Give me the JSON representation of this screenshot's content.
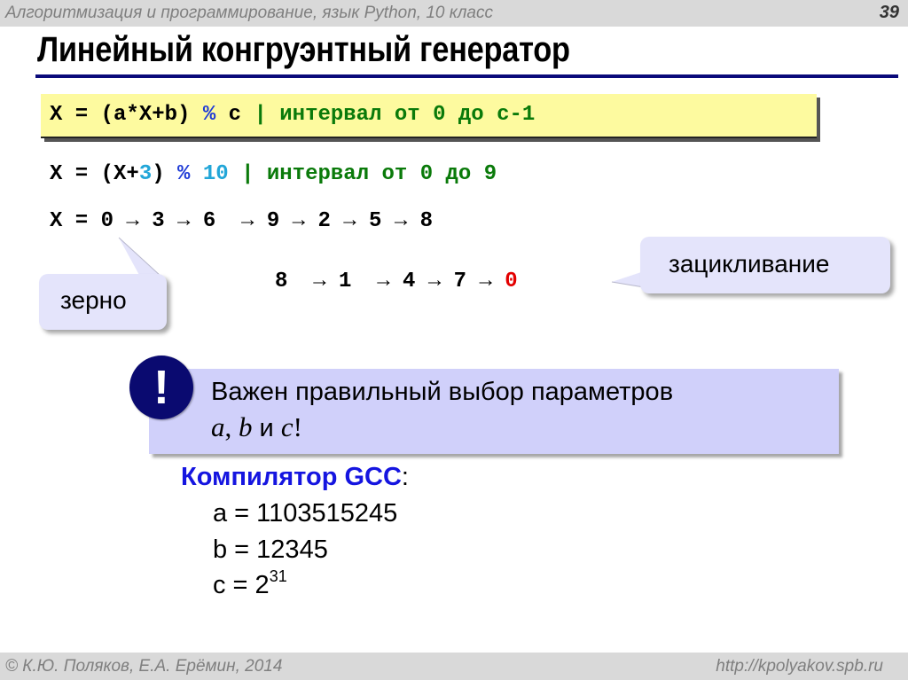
{
  "header": {
    "course": "Алгоритмизация и программирование, язык Python, 10 класс",
    "slide_number": "39"
  },
  "title": "Линейный конгруэнтный генератор",
  "formula": {
    "lhs": "X = (a*X+b) ",
    "op": "%",
    "rhs": " c ",
    "comment": "| интервал от 0 до c-1"
  },
  "example": {
    "prefix": "X = (X+",
    "inc": "3",
    "mid": ") ",
    "op": "%",
    "sp": " ",
    "mod": "10",
    "comment": " | интервал от 0 до 9"
  },
  "sequence": {
    "row1": "X = 0 → 3 → 6  → 9 → 2 → 5 → 8",
    "row2_prefix": "8  → 1  → 4 → 7 → ",
    "row2_last": "0"
  },
  "callouts": {
    "seed": "зерно",
    "cycle": "зацикливание"
  },
  "note": {
    "icon": "!",
    "line1": "Важен правильный выбор параметров",
    "a": "a",
    "comma": ", ",
    "b": "b",
    "and": " и ",
    "c": "c",
    "bang": "!"
  },
  "gcc": {
    "title": "Компилятор GCC",
    "colon": ":",
    "a": "a = 1103515245",
    "b": "b = 12345",
    "c_base": "c = 2",
    "c_exp": "31"
  },
  "footer": {
    "authors": "© К.Ю. Поляков, Е.А. Ерёмин, 2014",
    "site": "http://kpolyakov.spb.ru"
  }
}
